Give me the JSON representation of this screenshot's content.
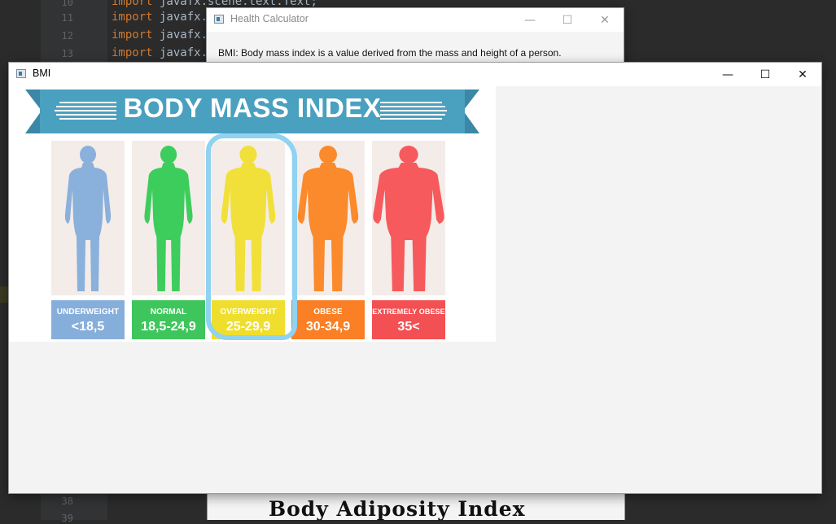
{
  "ide": {
    "line_numbers": [
      "10",
      "11",
      "12",
      "13",
      "38",
      "39"
    ],
    "code_lines": [
      {
        "keyword": "import",
        "text": " javafx.scene.text.Text;"
      },
      {
        "keyword": "import",
        "text": " javafx.s"
      },
      {
        "keyword": "import",
        "text": " javafx.s"
      },
      {
        "keyword": "import",
        "text": " javafx.s"
      }
    ]
  },
  "health_window": {
    "title": "Health Calculator",
    "description": "BMI: Body mass index is a value derived from the mass and height of a person.",
    "bottom_heading": "Body Adiposity Index"
  },
  "bmi_window": {
    "title": "BMI",
    "banner_title": "BODY MASS INDEX",
    "categories": [
      {
        "label": "UNDERWEIGHT",
        "range": "<18,5",
        "color": "#86aedb",
        "figure_color": "#8ab0dc"
      },
      {
        "label": "NORMAL",
        "range": "18,5-24,9",
        "color": "#3ec65c",
        "figure_color": "#3ccd5c"
      },
      {
        "label": "OVERWEIGHT",
        "range": "25-29,9",
        "color": "#f0de2e",
        "figure_color": "#f1e03a"
      },
      {
        "label": "OBESE",
        "range": "30-34,9",
        "color": "#fa7f25",
        "figure_color": "#fb8a2c"
      },
      {
        "label": "EXTREMELY OBESE",
        "range": "35<",
        "color": "#f25053",
        "figure_color": "#f65a5c"
      }
    ],
    "highlighted": "OVERWEIGHT"
  },
  "window_controls": {
    "minimize": "—",
    "maximize": "☐",
    "close": "✕"
  },
  "colors": {
    "banner": "#4aa0bf",
    "banner_dark": "#3b87a5",
    "highlight_ring": "#8fd2f1"
  }
}
